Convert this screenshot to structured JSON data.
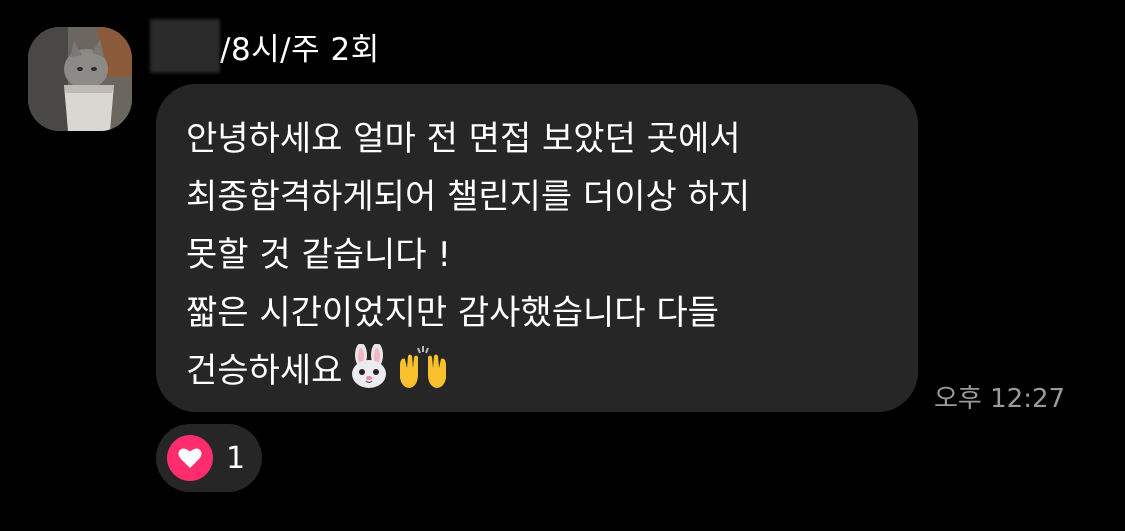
{
  "sender": {
    "name_redacted": true,
    "suffix": "/8시/주 2회"
  },
  "avatar": {
    "icon": "cat-in-box-photo-icon"
  },
  "message": {
    "text": "안녕하세요 얼마 전 면접 보았던 곳에서\n최종합격하게되어 챌린지를 더이상 하지\n못할 것 같습니다 !\n짧은 시간이었지만 감사했습니다 다들\n건승하세요",
    "emojis": [
      "rabbit-face-emoji",
      "raising-hands-emoji"
    ],
    "timestamp": "오후 12:27"
  },
  "reaction": {
    "icon": "heart-icon",
    "count": "1",
    "color": "#ff2d6d"
  },
  "colors": {
    "background": "#000000",
    "bubble": "#262626",
    "timestamp": "#9a9a9a",
    "heart": "#ff2d6d"
  }
}
